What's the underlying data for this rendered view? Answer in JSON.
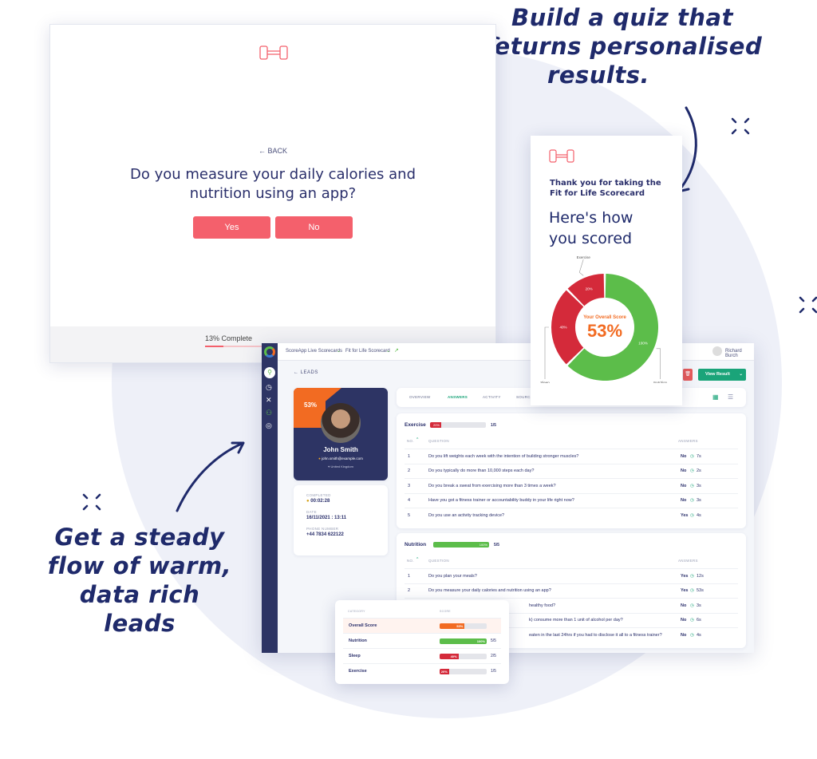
{
  "callouts": {
    "top": [
      "Build a quiz that",
      "returns personalised",
      "results."
    ],
    "bottom": [
      "Get a steady",
      "flow of warm,",
      "data rich",
      "leads"
    ]
  },
  "colors": {
    "navy": "#2d3464",
    "coral": "#f4606c",
    "green": "#5cbd4a",
    "red": "#d42a3a",
    "orange": "#f26b22",
    "teal": "#1aa479"
  },
  "quiz": {
    "back": "← BACK",
    "question_line1": "Do you measure your daily calories and",
    "question_line2": "nutrition using an app?",
    "yes": "Yes",
    "no": "No",
    "progress_label": "13% Complete",
    "progress": 13
  },
  "dashboard": {
    "breadcrumb": [
      "ScoreApp Live Scorecards",
      "Fit for Life Scorecard"
    ],
    "user": "Richard Burch",
    "back": "← LEADS",
    "view_result": "View Result",
    "lead": {
      "score": "53%",
      "name": "John Smith",
      "email": "john.smith@example.com",
      "location": "United Kingdom",
      "completed_label": "COMPLETED",
      "completed": "00:02:28",
      "date_label": "DATE",
      "date": "16/11/2021 : 13:11",
      "phone_label": "PHONE NUMBER",
      "phone": "+44 7834 622122"
    },
    "tabs": [
      "OVERVIEW",
      "ANSWERS",
      "ACTIVITY",
      "SOURCE"
    ],
    "active_tab": "ANSWERS",
    "col_no": "NO.",
    "col_question": "QUESTION",
    "col_answers": "ANSWERS",
    "sections": [
      {
        "name": "Exercise",
        "pct": 20,
        "pct_label": "20%",
        "fraction": "1/5",
        "color": "#d42a3a",
        "rows": [
          {
            "no": "1",
            "q": "Do you lift weights each week with the intention of building stronger muscles?",
            "a": "No",
            "t": "7s"
          },
          {
            "no": "2",
            "q": "Do you typically do more than 10,000 steps each day?",
            "a": "No",
            "t": "2s"
          },
          {
            "no": "3",
            "q": "Do you break a sweat from exercising more than 3 times a week?",
            "a": "No",
            "t": "3s"
          },
          {
            "no": "4",
            "q": "Have you got a fitness trainer or accountability buddy in your life right now?",
            "a": "No",
            "t": "3s"
          },
          {
            "no": "5",
            "q": "Do you use an activity tracking device?",
            "a": "Yes",
            "t": "4s"
          }
        ]
      },
      {
        "name": "Nutrition",
        "pct": 100,
        "pct_label": "100%",
        "fraction": "5/5",
        "color": "#5cbd4a",
        "rows": [
          {
            "no": "1",
            "q": "Do you plan your meals?",
            "a": "Yes",
            "t": "12s"
          },
          {
            "no": "2",
            "q": "Do you measure your daily calories and nutrition using an app?",
            "a": "Yes",
            "t": "53s"
          },
          {
            "no": "",
            "q": "healthy food?",
            "a": "No",
            "t": "3s"
          },
          {
            "no": "",
            "q": "k) consume more than 1 unit of alcohol per day?",
            "a": "No",
            "t": "6s"
          },
          {
            "no": "",
            "q": "eaten in the last 24hrs if you had to disclose it all to a fitness trainer?",
            "a": "No",
            "t": "4s"
          }
        ]
      }
    ]
  },
  "scorecard": {
    "thanks_line1": "Thank you for taking the",
    "thanks_line2": "Fit for Life Scorecard",
    "heading_line1": "Here's how",
    "heading_line2": "you scored",
    "center_label": "Your Overall Score",
    "center_value": "53%"
  },
  "chart_data": {
    "type": "pie",
    "variant": "donut",
    "categories": [
      "Nutrition",
      "Sleep",
      "Exercise"
    ],
    "values": [
      100,
      40,
      20
    ],
    "labels": [
      "100%",
      "40%",
      "20%"
    ],
    "colors": [
      "#5cbd4a",
      "#d42a3a",
      "#d42a3a"
    ]
  },
  "popup": {
    "col_category": "CATEGORY",
    "col_score": "SCORE",
    "rows": [
      {
        "label": "Overall Score",
        "pct": 53,
        "pct_label": "53%",
        "fraction": "",
        "color": "#f26b22"
      },
      {
        "label": "Nutrition",
        "pct": 100,
        "pct_label": "100%",
        "fraction": "5/5",
        "color": "#5cbd4a"
      },
      {
        "label": "Sleep",
        "pct": 40,
        "pct_label": "40%",
        "fraction": "2/5",
        "color": "#d42a3a"
      },
      {
        "label": "Exercise",
        "pct": 20,
        "pct_label": "20%",
        "fraction": "1/5",
        "color": "#d42a3a"
      }
    ]
  }
}
